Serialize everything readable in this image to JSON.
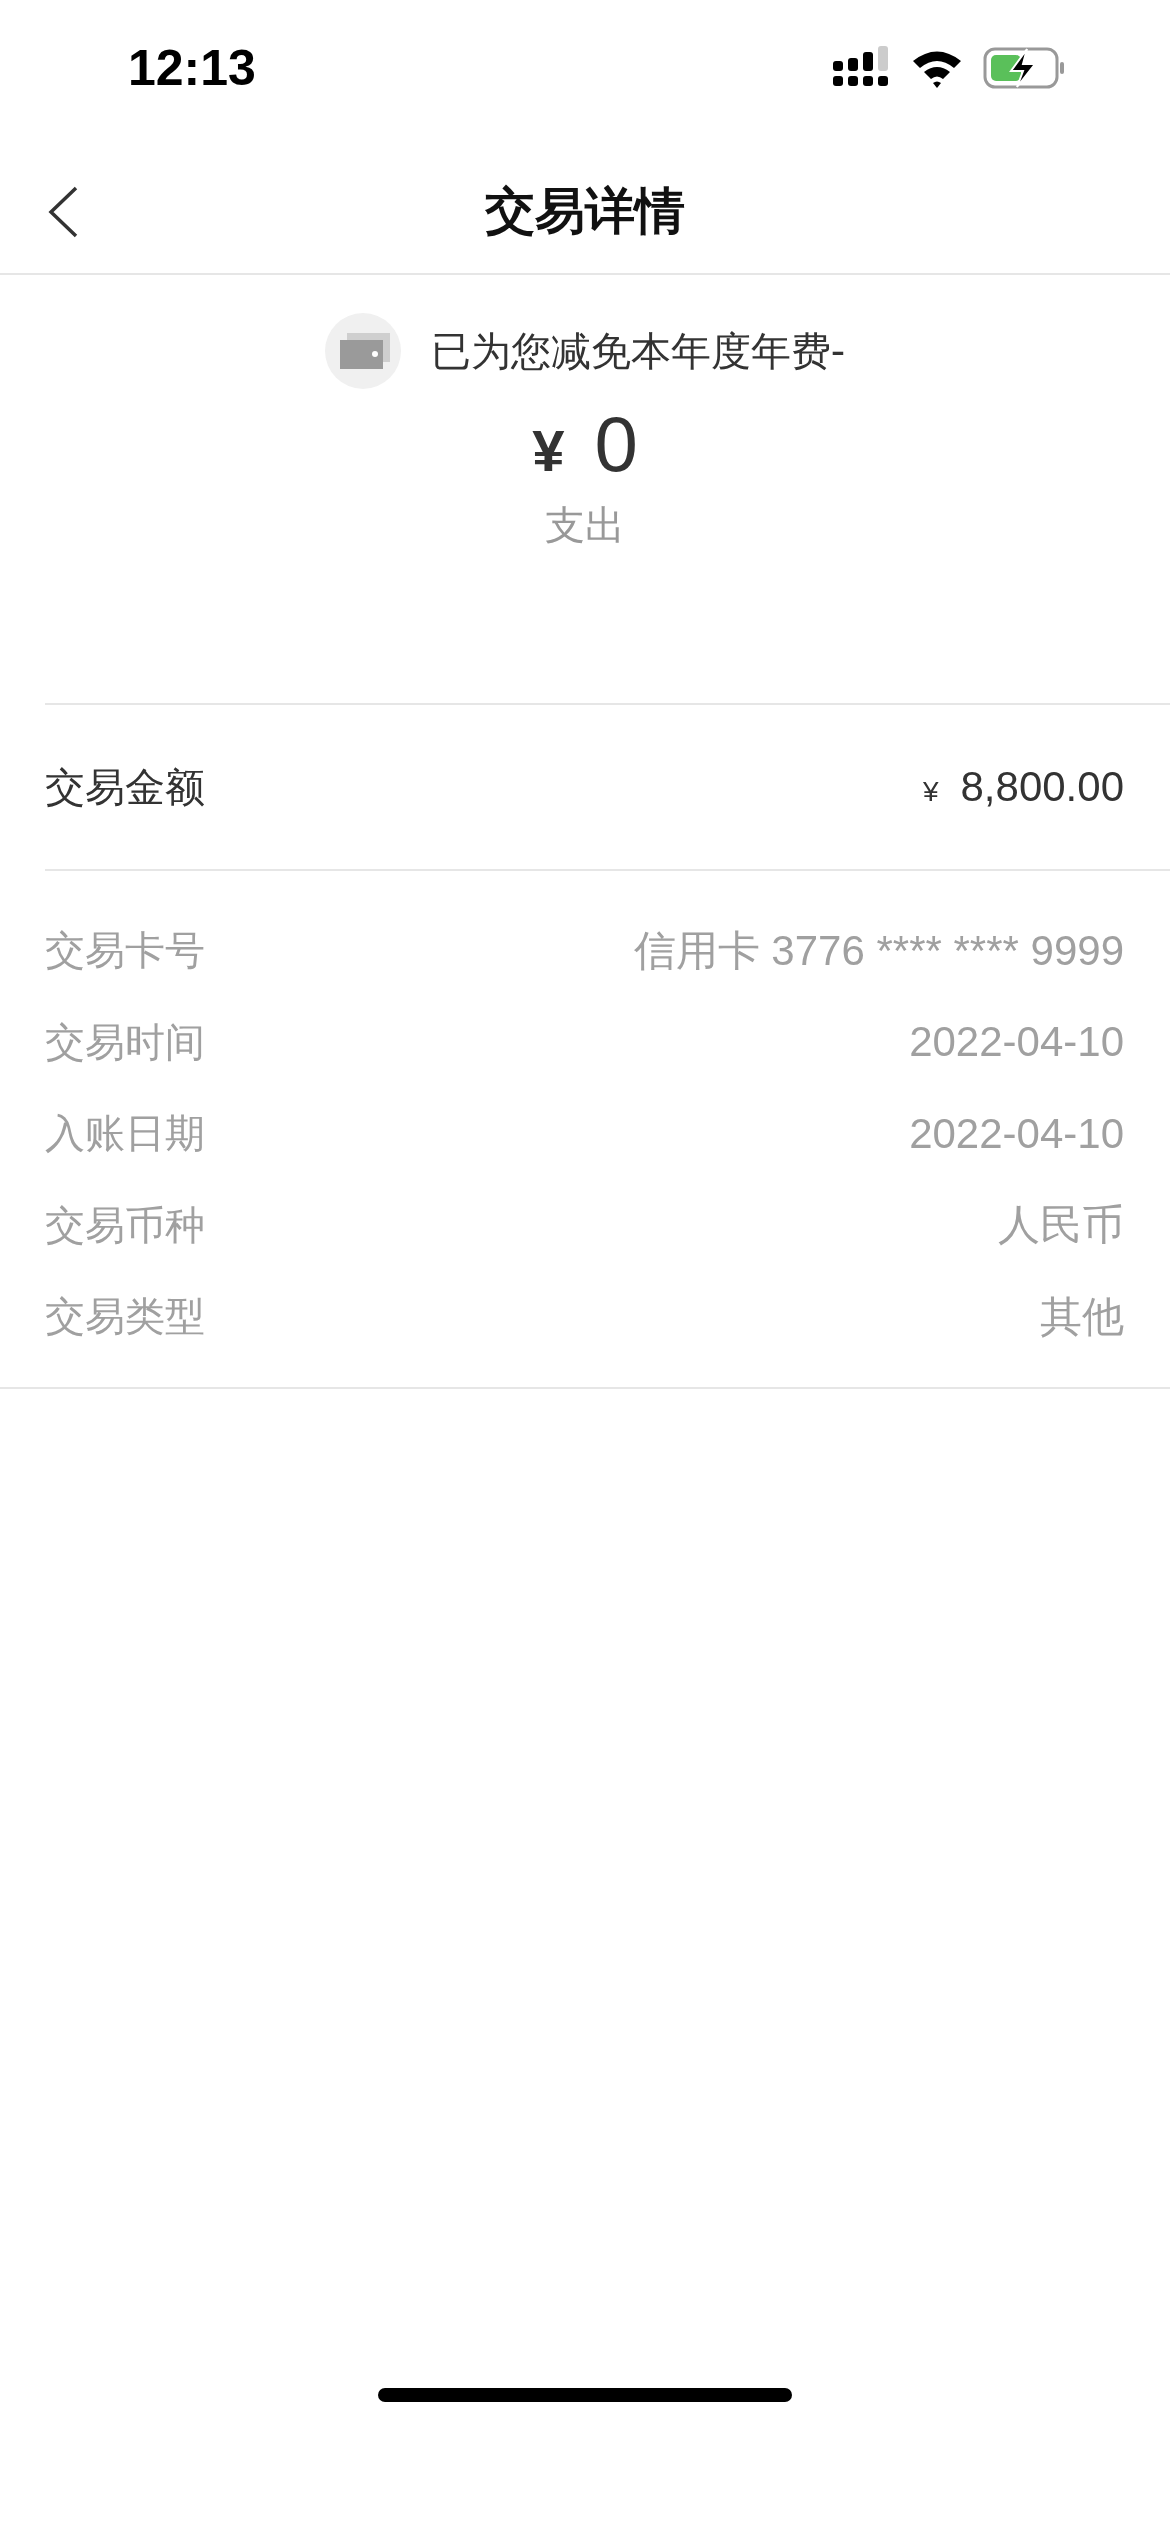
{
  "status_bar": {
    "time": "12:13"
  },
  "nav": {
    "title": "交易详情"
  },
  "summary": {
    "notice": "已为您减免本年度年费-",
    "currency": "¥",
    "amount": "0",
    "direction": "支出"
  },
  "amount_row": {
    "label": "交易金额",
    "currency": "¥",
    "value": "8,800.00"
  },
  "details": [
    {
      "label": "交易卡号",
      "value": "信用卡 3776 **** **** 9999"
    },
    {
      "label": "交易时间",
      "value": "2022-04-10"
    },
    {
      "label": "入账日期",
      "value": "2022-04-10"
    },
    {
      "label": "交易币种",
      "value": "人民币"
    },
    {
      "label": "交易类型",
      "value": "其他"
    }
  ]
}
